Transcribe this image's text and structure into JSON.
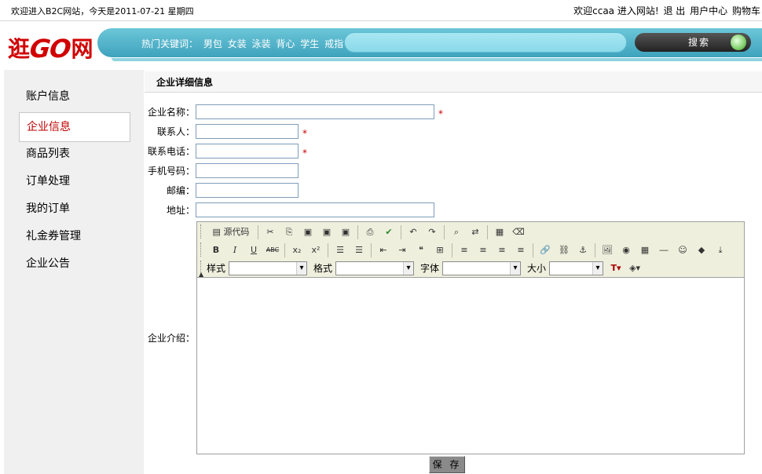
{
  "topbar": {
    "welcome": "欢迎进入B2C网站，今天是2011-07-21 星期四",
    "user_greeting": "欢迎ccaa 进入网站!",
    "logout": "退 出",
    "user_center": "用户中心",
    "cart": "购物车"
  },
  "header": {
    "logo_left": "逛",
    "logo_mid": "GO",
    "logo_right": "网",
    "hot_label": "热门关键词：",
    "hot_keywords": [
      "男包",
      "女装",
      "泳装",
      "背心",
      "学生",
      "戒指"
    ],
    "search_button": "搜索",
    "search_placeholder": ""
  },
  "sidebar": {
    "items": [
      {
        "label": "账户信息",
        "active": false
      },
      {
        "label": "企业信息",
        "active": true
      },
      {
        "label": "商品列表",
        "active": false
      },
      {
        "label": "订单处理",
        "active": false
      },
      {
        "label": "我的订单",
        "active": false
      },
      {
        "label": "礼金券管理",
        "active": false
      },
      {
        "label": "企业公告",
        "active": false
      }
    ]
  },
  "main": {
    "section_title": "企业详细信息",
    "fields": {
      "company_name": {
        "label": "企业名称：",
        "value": "",
        "required_mark": "*"
      },
      "contact": {
        "label": "联系人：",
        "value": "",
        "required_mark": "*"
      },
      "phone": {
        "label": "联系电话：",
        "value": "",
        "required_mark": "*"
      },
      "mobile": {
        "label": "手机号码：",
        "value": ""
      },
      "postcode": {
        "label": "邮编：",
        "value": ""
      },
      "address": {
        "label": "地址：",
        "value": ""
      },
      "intro": {
        "label": "企业介绍："
      }
    },
    "editor": {
      "source_label": "源代码",
      "style_label": "样式",
      "format_label": "格式",
      "font_label": "字体",
      "size_label": "大小",
      "bold": "B",
      "italic": "I",
      "underline": "U",
      "strike": "ABC",
      "subscript": "x₂",
      "superscript": "x²",
      "content": ""
    },
    "save_button": "保 存"
  },
  "colors": {
    "accent_red": "#c00000",
    "search_bar": "#3ea3bd",
    "sidebar_bg": "#f0f0f0"
  }
}
